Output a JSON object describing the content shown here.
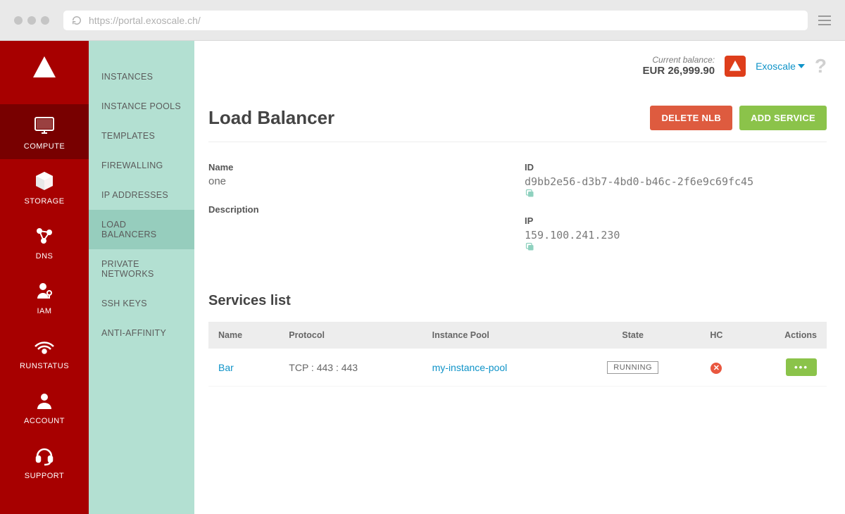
{
  "browser": {
    "url": "https://portal.exoscale.ch/"
  },
  "primaryNav": {
    "items": [
      {
        "label": "COMPUTE"
      },
      {
        "label": "STORAGE"
      },
      {
        "label": "DNS"
      },
      {
        "label": "IAM"
      },
      {
        "label": "RUNSTATUS"
      },
      {
        "label": "ACCOUNT"
      },
      {
        "label": "SUPPORT"
      }
    ]
  },
  "secondaryNav": {
    "items": [
      {
        "label": "INSTANCES"
      },
      {
        "label": "INSTANCE POOLS"
      },
      {
        "label": "TEMPLATES"
      },
      {
        "label": "FIREWALLING"
      },
      {
        "label": "IP ADDRESSES"
      },
      {
        "label": "LOAD BALANCERS"
      },
      {
        "label": "PRIVATE NETWORKS"
      },
      {
        "label": "SSH KEYS"
      },
      {
        "label": "ANTI-AFFINITY"
      }
    ]
  },
  "topbar": {
    "balance_label": "Current balance:",
    "balance_currency": "EUR",
    "balance_amount": "26,999.90",
    "org_name": "Exoscale"
  },
  "page": {
    "title": "Load Balancer",
    "delete_btn": "DELETE NLB",
    "add_btn": "ADD SERVICE",
    "labels": {
      "name": "Name",
      "id": "ID",
      "description": "Description",
      "ip": "IP"
    },
    "name": "one",
    "id": "d9bb2e56-d3b7-4bd0-b46c-2f6e9c69fc45",
    "description": "",
    "ip": "159.100.241.230"
  },
  "services": {
    "title": "Services list",
    "columns": {
      "name": "Name",
      "protocol": "Protocol",
      "pool": "Instance Pool",
      "state": "State",
      "hc": "HC",
      "actions": "Actions"
    },
    "rows": [
      {
        "name": "Bar",
        "protocol": "TCP : 443 : 443",
        "pool": "my-instance-pool",
        "state": "RUNNING",
        "hc": "bad"
      }
    ]
  }
}
